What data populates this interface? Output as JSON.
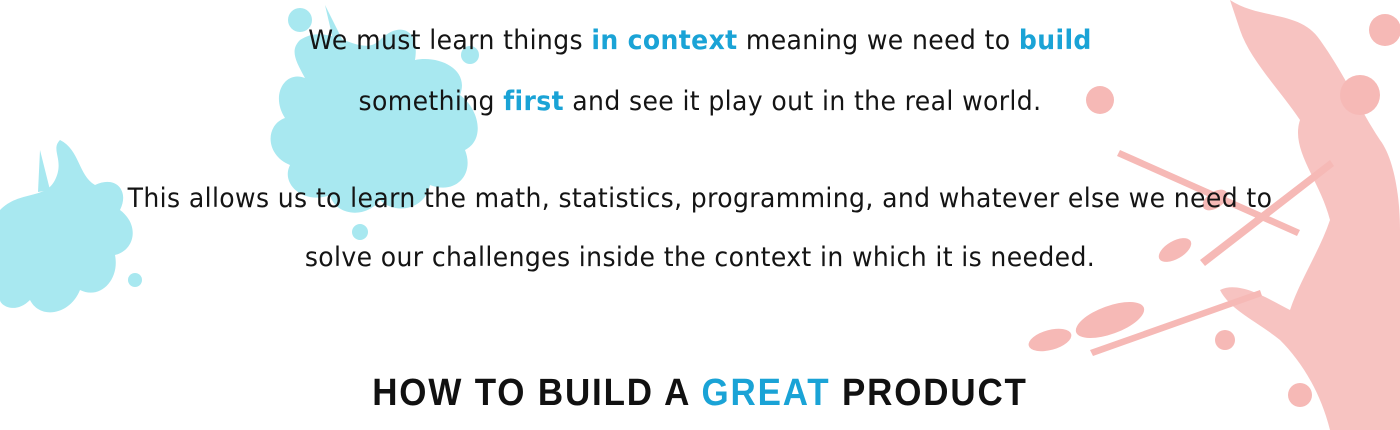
{
  "colors": {
    "accent": "#1aa3d6",
    "text": "#141414",
    "splash_blue": "#a8e8f0",
    "splash_pink": "#f6b9b6"
  },
  "paragraph1": {
    "line1": {
      "a": "We must learn things ",
      "b": "in context",
      "c": " meaning we need to ",
      "d": "build"
    },
    "line2": {
      "a": "something ",
      "b": "first",
      "c": " and see it play out in the real world."
    }
  },
  "paragraph2": {
    "line1": "This allows us to learn the math, statistics, programming, and whatever else we need to",
    "line2": "solve our challenges inside the context in which it is needed."
  },
  "heading": {
    "a": "HOW TO BUILD A ",
    "b": "GREAT",
    "c": " PRODUCT"
  }
}
